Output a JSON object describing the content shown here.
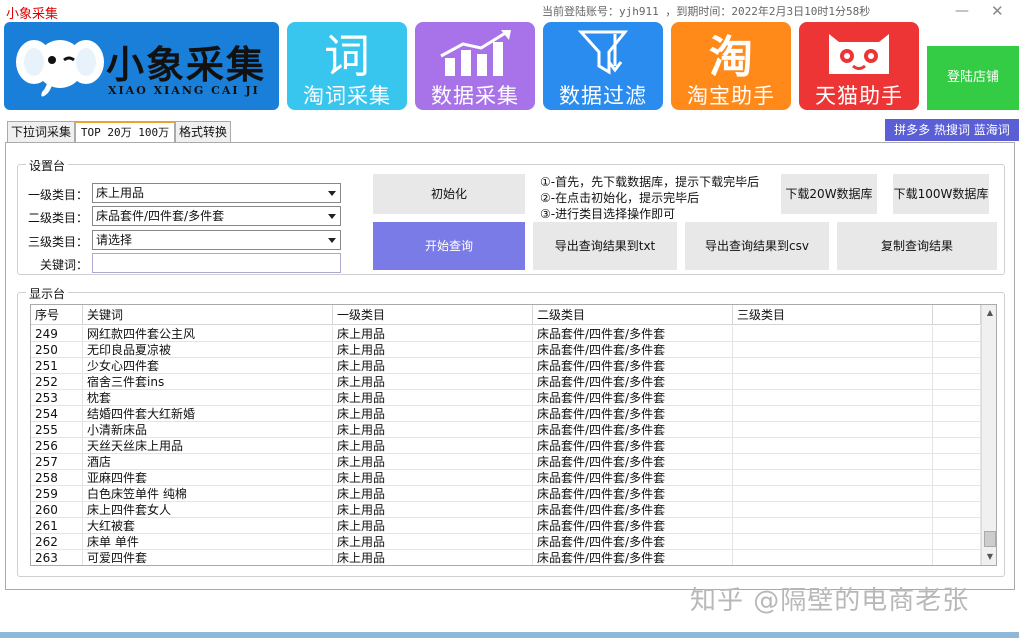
{
  "window": {
    "title": "小象采集",
    "account_info": "当前登陆账号：yjh911 ，到期时间：2022年2月3日10时1分58秒",
    "minimize_symbol": "—",
    "close_symbol": "✕"
  },
  "banner": {
    "logo_title": "小象采集",
    "logo_subtitle": "XIAO XIANG CAI JI",
    "tiles": [
      {
        "label": "淘词采集",
        "icon": "ci-character-icon",
        "color": "#38c6ee"
      },
      {
        "label": "数据采集",
        "icon": "bar-chart-icon",
        "color": "#a873e8"
      },
      {
        "label": "数据过滤",
        "icon": "funnel-icon",
        "color": "#2b8cf0"
      },
      {
        "label": "淘宝助手",
        "icon": "taobao-icon",
        "color": "#ff8a1a"
      },
      {
        "label": "天猫助手",
        "icon": "tmall-cat-icon",
        "color": "#ee3535"
      }
    ],
    "tile_glyphs": {
      "ci": "词",
      "tao": "淘"
    },
    "login_label": "登陆店铺"
  },
  "tabs": [
    {
      "label": "下拉词采集"
    },
    {
      "label": "TOP 20万 100万"
    },
    {
      "label": "格式转换"
    }
  ],
  "promo": "拼多多 热搜词 蓝海词",
  "settings": {
    "group_label": "设置台",
    "level1_label": "一级类目：",
    "level1_value": "床上用品",
    "level2_label": "二级类目：",
    "level2_value": "床品套件/四件套/多件套",
    "level3_label": "三级类目：",
    "level3_value": "请选择",
    "keyword_label": "关键词：",
    "keyword_value": "",
    "init_button": "初始化",
    "start_button": "开始查询",
    "instructions": [
      "①-首先，先下载数据库，提示下载完毕后",
      "②-在点击初始化，提示完毕后",
      "③-进行类目选择操作即可"
    ],
    "download_20w": "下载20W数据库",
    "download_100w": "下载100W数据库",
    "export_txt": "导出查询结果到txt",
    "export_csv": "导出查询结果到csv",
    "copy_results": "复制查询结果"
  },
  "display": {
    "group_label": "显示台",
    "columns": [
      "序号",
      "关键词",
      "一级类目",
      "二级类目",
      "三级类目",
      ""
    ],
    "rows": [
      [
        "249",
        "网红款四件套公主风",
        "床上用品",
        "床品套件/四件套/多件套",
        ""
      ],
      [
        "250",
        "无印良品夏凉被",
        "床上用品",
        "床品套件/四件套/多件套",
        ""
      ],
      [
        "251",
        "少女心四件套",
        "床上用品",
        "床品套件/四件套/多件套",
        ""
      ],
      [
        "252",
        "宿舍三件套ins",
        "床上用品",
        "床品套件/四件套/多件套",
        ""
      ],
      [
        "253",
        "枕套",
        "床上用品",
        "床品套件/四件套/多件套",
        ""
      ],
      [
        "254",
        "结婚四件套大红新婚",
        "床上用品",
        "床品套件/四件套/多件套",
        ""
      ],
      [
        "255",
        "小清新床品",
        "床上用品",
        "床品套件/四件套/多件套",
        ""
      ],
      [
        "256",
        "天丝天丝床上用品",
        "床上用品",
        "床品套件/四件套/多件套",
        ""
      ],
      [
        "257",
        "酒店",
        "床上用品",
        "床品套件/四件套/多件套",
        ""
      ],
      [
        "258",
        "亚麻四件套",
        "床上用品",
        "床品套件/四件套/多件套",
        ""
      ],
      [
        "259",
        "白色床笠单件 纯棉",
        "床上用品",
        "床品套件/四件套/多件套",
        ""
      ],
      [
        "260",
        "床上四件套女人",
        "床上用品",
        "床品套件/四件套/多件套",
        ""
      ],
      [
        "261",
        "大红被套",
        "床上用品",
        "床品套件/四件套/多件套",
        ""
      ],
      [
        "262",
        "床单 单件",
        "床上用品",
        "床品套件/四件套/多件套",
        ""
      ],
      [
        "263",
        "可爱四件套",
        "床上用品",
        "床品套件/四件套/多件套",
        ""
      ]
    ],
    "scroll_up": "▲",
    "scroll_down": "▼"
  },
  "watermark": "知乎 @隔壁的电商老张"
}
